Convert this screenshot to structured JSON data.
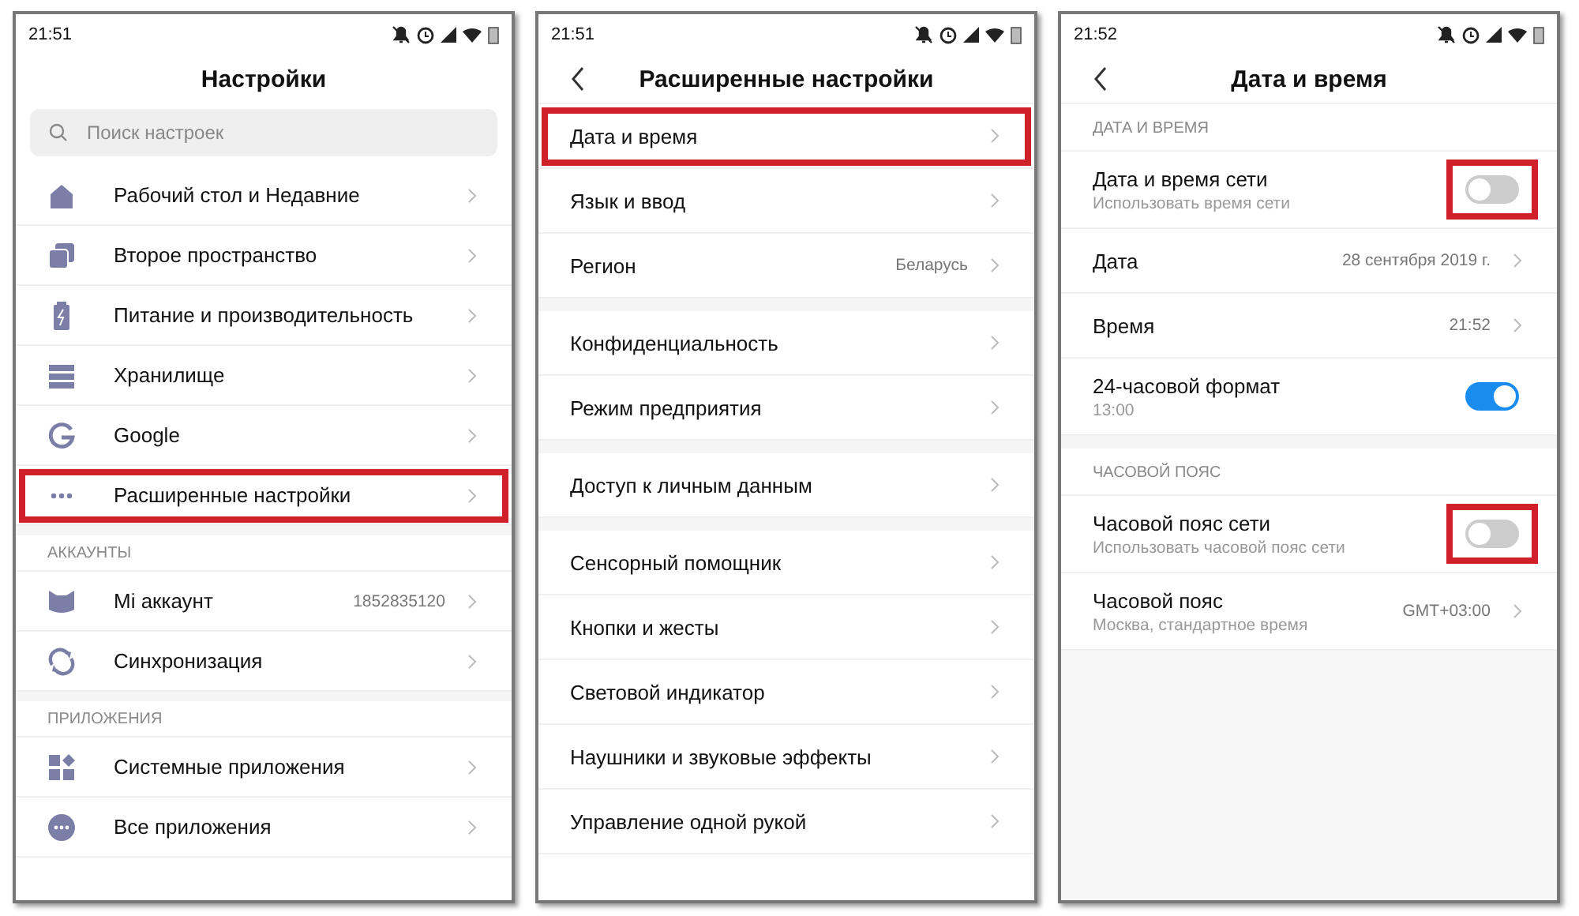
{
  "panels": [
    {
      "status_time": "21:51",
      "title": "Настройки",
      "search": {
        "placeholder": "Поиск настроек"
      },
      "sections": [
        {
          "items": [
            {
              "label": "Рабочий стол и Недавние",
              "kind": "link",
              "highlighted": false
            },
            {
              "label": "Второе пространство",
              "kind": "link",
              "highlighted": false
            },
            {
              "label": "Питание и производительность",
              "kind": "link",
              "highlighted": false
            },
            {
              "label": "Хранилище",
              "kind": "link",
              "highlighted": false
            },
            {
              "label": "Google",
              "kind": "link",
              "highlighted": false
            },
            {
              "label": "Расширенные настройки",
              "kind": "link",
              "highlighted": true
            }
          ]
        },
        {
          "header": "АККАУНТЫ",
          "items": [
            {
              "label": "Mi аккаунт",
              "value": "1852835120",
              "kind": "link",
              "highlighted": false
            },
            {
              "label": "Синхронизация",
              "kind": "link",
              "highlighted": false
            }
          ]
        },
        {
          "header": "ПРИЛОЖЕНИЯ",
          "items": [
            {
              "label": "Системные приложения",
              "kind": "link",
              "highlighted": false
            },
            {
              "label": "Все приложения",
              "kind": "link",
              "highlighted": false
            }
          ]
        }
      ]
    },
    {
      "status_time": "21:51",
      "title": "Расширенные настройки",
      "sections": [
        {
          "items": [
            {
              "label": "Дата и время",
              "kind": "link",
              "highlighted": true
            },
            {
              "label": "Язык и ввод",
              "kind": "link",
              "highlighted": false
            },
            {
              "label": "Регион",
              "value": "Беларусь",
              "kind": "link",
              "highlighted": false
            }
          ]
        },
        {
          "items": [
            {
              "label": "Конфиденциальность",
              "kind": "link",
              "highlighted": false
            },
            {
              "label": "Режим предприятия",
              "kind": "link",
              "highlighted": false
            }
          ]
        },
        {
          "items": [
            {
              "label": "Доступ к личным данным",
              "kind": "link",
              "highlighted": false
            }
          ]
        },
        {
          "items": [
            {
              "label": "Сенсорный помощник",
              "kind": "link",
              "highlighted": false
            },
            {
              "label": "Кнопки и жесты",
              "kind": "link",
              "highlighted": false
            },
            {
              "label": "Световой индикатор",
              "kind": "link",
              "highlighted": false
            },
            {
              "label": "Наушники и звуковые эффекты",
              "kind": "link",
              "highlighted": false
            },
            {
              "label": "Управление одной рукой",
              "kind": "link",
              "highlighted": false
            }
          ]
        }
      ]
    },
    {
      "status_time": "21:52",
      "title": "Дата и время",
      "sections": [
        {
          "header": "ДАТА И ВРЕМЯ",
          "items": [
            {
              "label": "Дата и время сети",
              "sublabel": "Использовать время сети",
              "kind": "toggle",
              "on": false,
              "highlighted": true
            },
            {
              "label": "Дата",
              "value": "28 сентября 2019 г.",
              "kind": "link",
              "highlighted": false
            },
            {
              "label": "Время",
              "value": "21:52",
              "kind": "link",
              "highlighted": false
            },
            {
              "label": "24-часовой формат",
              "sublabel": "13:00",
              "kind": "toggle",
              "on": true,
              "highlighted": false
            }
          ]
        },
        {
          "header": "ЧАСОВОЙ ПОЯС",
          "items": [
            {
              "label": "Часовой пояс сети",
              "sublabel": "Использовать часовой пояс сети",
              "kind": "toggle",
              "on": false,
              "highlighted": true
            },
            {
              "label": "Часовой пояс",
              "sublabel": "Москва, стандартное время",
              "value": "GMT+03:00",
              "kind": "link",
              "highlighted": false
            }
          ]
        }
      ]
    }
  ]
}
